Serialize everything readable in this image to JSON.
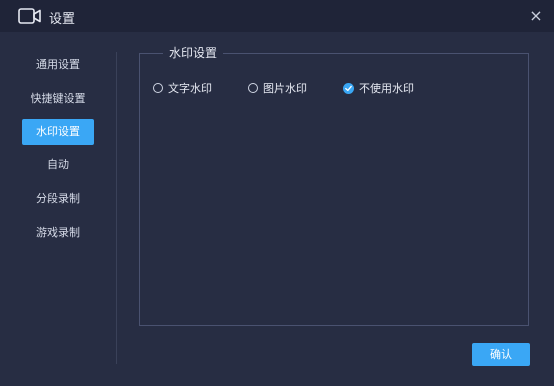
{
  "window": {
    "title": "设置",
    "close_symbol": "×"
  },
  "icons": {
    "title": "video-camera-icon",
    "close": "close-icon",
    "check": "check-icon"
  },
  "colors": {
    "accent": "#3aa7f5",
    "background": "#272d43",
    "titlebar": "#1f2438"
  },
  "sidebar": {
    "items": [
      {
        "label": "通用设置",
        "active": false
      },
      {
        "label": "快捷键设置",
        "active": false
      },
      {
        "label": "水印设置",
        "active": true
      },
      {
        "label": "自动",
        "active": false
      },
      {
        "label": "分段录制",
        "active": false
      },
      {
        "label": "游戏录制",
        "active": false
      }
    ]
  },
  "watermark": {
    "group_title": "水印设置",
    "options": [
      {
        "label": "文字水印",
        "checked": false
      },
      {
        "label": "图片水印",
        "checked": false
      },
      {
        "label": "不使用水印",
        "checked": true
      }
    ]
  },
  "footer": {
    "confirm_label": "确认"
  }
}
